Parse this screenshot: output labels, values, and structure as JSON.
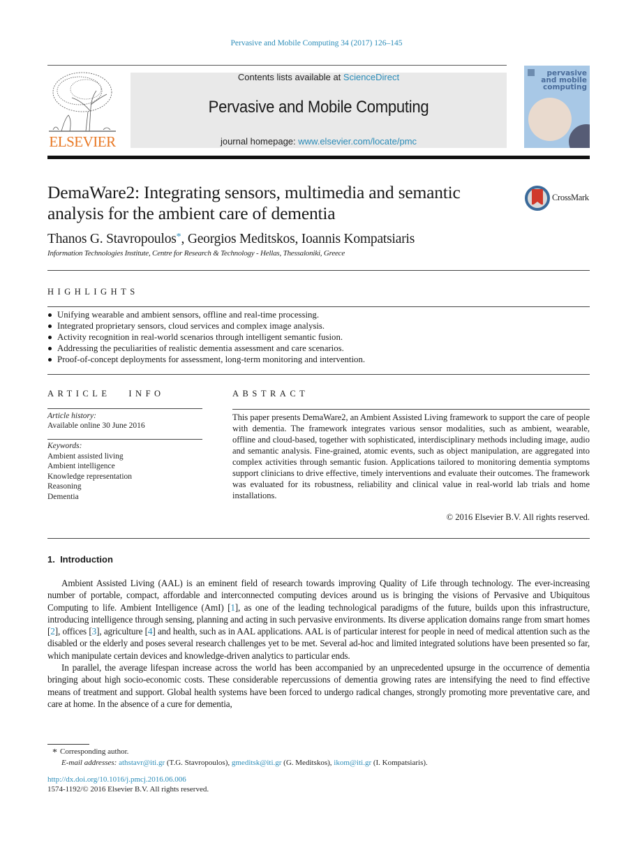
{
  "header": {
    "journal_ref": "Pervasive and Mobile Computing 34 (2017) 126–145",
    "contents_prefix": "Contents lists available at ",
    "contents_link": "ScienceDirect",
    "journal_title": "Pervasive and Mobile Computing",
    "homepage_prefix": "journal homepage: ",
    "homepage_link": "www.elsevier.com/locate/pmc",
    "publisher_logo": "ELSEVIER",
    "cover_title_lines": [
      "pervasive",
      "and mobile",
      "computing"
    ],
    "crossmark_label": "CrossMark"
  },
  "article": {
    "title": "DemaWare2: Integrating sensors, multimedia and semantic analysis for the ambient care of dementia",
    "authors": [
      {
        "name": "Thanos G. Stavropoulos",
        "corresponding": true
      },
      {
        "name": "Georgios Meditskos",
        "corresponding": false
      },
      {
        "name": "Ioannis Kompatsiaris",
        "corresponding": false
      }
    ],
    "corresponding_mark": "*",
    "affiliation": "Information Technologies Institute, Centre for Research & Technology - Hellas, Thessaloniki, Greece"
  },
  "highlights": {
    "heading": "HIGHLIGHTS",
    "items": [
      "Unifying wearable and ambient sensors, offline and real-time processing.",
      "Integrated proprietary sensors, cloud services and complex image analysis.",
      "Activity recognition in real-world scenarios through intelligent semantic fusion.",
      "Addressing the peculiarities of realistic dementia assessment and care scenarios.",
      "Proof-of-concept deployments for assessment, long-term monitoring and intervention."
    ]
  },
  "article_info": {
    "heading": "ARTICLE   INFO",
    "history_label": "Article history:",
    "history_value": "Available online 30 June 2016",
    "keywords_label": "Keywords:",
    "keywords": [
      "Ambient assisted living",
      "Ambient intelligence",
      "Knowledge representation",
      "Reasoning",
      "Dementia"
    ]
  },
  "abstract": {
    "heading": "ABSTRACT",
    "text": "This paper presents DemaWare2, an Ambient Assisted Living framework to support the care of people with dementia. The framework integrates various sensor modalities, such as ambient, wearable, offline and cloud-based, together with sophisticated, interdisciplinary methods including image, audio and semantic analysis. Fine-grained, atomic events, such as object manipulation, are aggregated into complex activities through semantic fusion. Applications tailored to monitoring dementia symptoms support clinicians to drive effective, timely interventions and evaluate their outcomes. The framework was evaluated for its robustness, reliability and clinical value in real-world lab trials and home installations.",
    "copyright": "© 2016 Elsevier B.V. All rights reserved."
  },
  "introduction": {
    "heading": "1.  Introduction",
    "p1": [
      {
        "t": "Ambient Assisted Living (AAL) is an eminent field of research towards improving Quality of Life through technology. The ever-increasing number of portable, compact, affordable and interconnected computing devices around us is bringing the visions of Pervasive and Ubiquitous Computing to life. Ambient Intelligence (AmI) ["
      },
      {
        "ref": "1"
      },
      {
        "t": "], as one of the leading technological paradigms of the future, builds upon this infrastructure, introducing intelligence through sensing, planning and acting in such pervasive environments. Its diverse application domains range from smart homes ["
      },
      {
        "ref": "2"
      },
      {
        "t": "], offices ["
      },
      {
        "ref": "3"
      },
      {
        "t": "], agriculture ["
      },
      {
        "ref": "4"
      },
      {
        "t": "] and health, such as in AAL applications. AAL is of particular interest for people in need of medical attention such as the disabled or the elderly and poses several research challenges yet to be met. Several ad-hoc and limited integrated solutions have been presented so far, which manipulate certain devices and knowledge-driven analytics to particular ends."
      }
    ],
    "p2": "In parallel, the average lifespan increase across the world has been accompanied by an unprecedented upsurge in the occurrence of dementia bringing about high socio-economic costs. These considerable repercussions of dementia growing rates are intensifying the need to find effective means of treatment and support. Global health systems have been forced to undergo radical changes, strongly promoting more preventative care, and care at home. In the absence of a cure for dementia,"
  },
  "footnotes": {
    "star": "*",
    "corresponding": "Corresponding author.",
    "email_label": "E-mail addresses:",
    "emails": [
      {
        "email": "athstavr@iti.gr",
        "who": " (T.G. Stavropoulos), "
      },
      {
        "email": "gmeditsk@iti.gr",
        "who": " (G. Meditskos), "
      },
      {
        "email": "ikom@iti.gr",
        "who": " (I. Kompatsiaris)."
      }
    ],
    "doi": "http://dx.doi.org/10.1016/j.pmcj.2016.06.006",
    "issn": "1574-1192/© 2016 Elsevier B.V. All rights reserved."
  },
  "colors": {
    "link": "#2b8cb8",
    "elsevier_orange": "#e87722",
    "header_band": "#e9e9e9",
    "cover_blue": "#a8c8e6",
    "crossmark_red": "#d0392b"
  }
}
